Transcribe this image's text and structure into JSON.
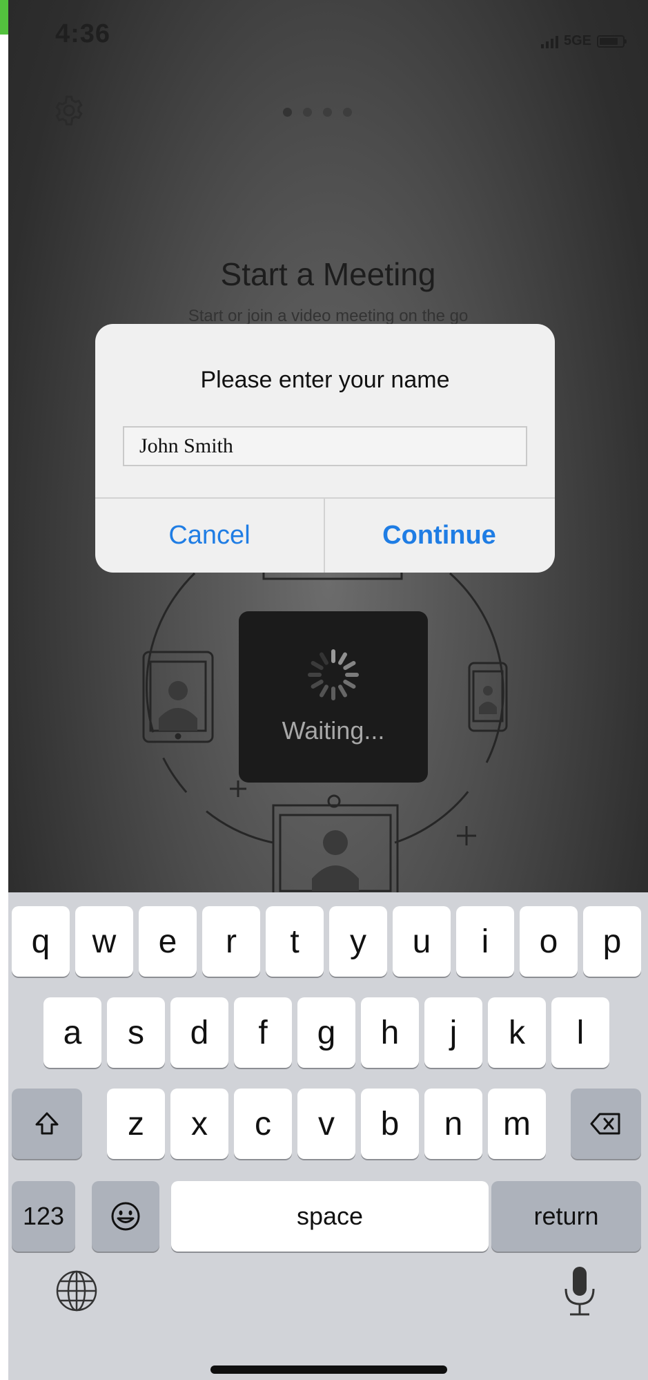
{
  "status_bar": {
    "time": "4:36",
    "network": "5GE",
    "signal_icon": "cellular-signal-icon",
    "battery_icon": "battery-icon"
  },
  "header": {
    "settings_icon": "gear-icon",
    "page_indicator": {
      "count": 4,
      "active_index": 0
    }
  },
  "background": {
    "title": "Start a Meeting",
    "subtitle": "Start or join a video meeting on the go"
  },
  "hud": {
    "text": "Waiting...",
    "icon": "activity-spinner-icon"
  },
  "dialog": {
    "title": "Please enter your name",
    "input_value": "John Smith",
    "cancel_label": "Cancel",
    "continue_label": "Continue"
  },
  "keyboard": {
    "row1": [
      "q",
      "w",
      "e",
      "r",
      "t",
      "y",
      "u",
      "i",
      "o",
      "p"
    ],
    "row2": [
      "a",
      "s",
      "d",
      "f",
      "g",
      "h",
      "j",
      "k",
      "l"
    ],
    "row3": [
      "z",
      "x",
      "c",
      "v",
      "b",
      "n",
      "m"
    ],
    "numbers_label": "123",
    "space_label": "space",
    "return_label": "return",
    "shift_icon": "shift-icon",
    "delete_icon": "backspace-icon",
    "emoji_icon": "emoji-icon",
    "globe_icon": "globe-icon",
    "mic_icon": "microphone-icon"
  },
  "colors": {
    "accent": "#1f7de4",
    "green_edge": "#53c23e",
    "keyboard_bg": "#d1d3d8"
  }
}
